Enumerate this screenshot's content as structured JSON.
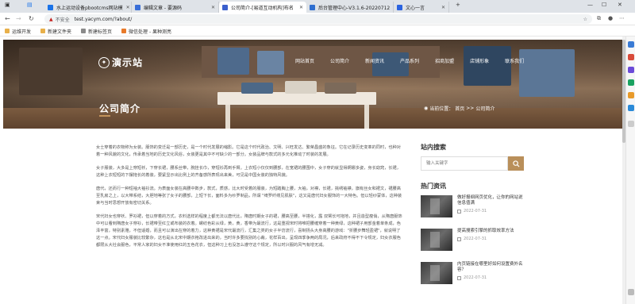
{
  "browser": {
    "tabs": [
      {
        "label": "水上运动设备pbootcms网站模",
        "color": "#1a73e8"
      },
      {
        "label": "编辑文章 - 要源码",
        "color": "#3a6fd8"
      },
      {
        "label": "公司简介-[易道互动机构]布名",
        "color": "#3a5fcd"
      },
      {
        "label": "后台管理中心-V3.1.6-20220712",
        "color": "#2f6fd0"
      },
      {
        "label": "文心一言",
        "color": "#2b63e0"
      }
    ],
    "new_tab": "+",
    "security_label": "不安全",
    "url": "test.yacym.com/?about/",
    "bookmarks": [
      {
        "label": "运维开发",
        "color": "#e8b04a"
      },
      {
        "label": "新建文件夹",
        "color": "#e8b04a"
      },
      {
        "label": "新建标签页",
        "color": "#8a8a8a"
      },
      {
        "label": "微信处理 - 果种测亮",
        "color": "#e87a2a"
      }
    ]
  },
  "site": {
    "logo_text": "演示站",
    "nav": [
      "网站首页",
      "公司简介",
      "新闻资讯",
      "产品系列",
      "招商加盟",
      "店铺形象",
      "联系我们"
    ],
    "page_title": "公司简介",
    "breadcrumb": {
      "prefix": "当前位置：",
      "home": "首页",
      "sep": ">>",
      "current": "公司简介"
    }
  },
  "article": {
    "paragraphs": [
      "女士穿着的衣物称为女装。服饰的变迁是一部历史，是一个时代发展的缩影。它是这个时代政治、文明、兴旺发达、繁荣昌盛的象征。它在记录历史变革的同时，也种对着一种风貌的文化，传承着当地的历史文化风俗，女装更是其中不可缺少的一部分。女装品牌与款式的多元化推动了时装的发展。",
      "女子服装，大多是上穿短袄，下穿长裙，腰系丝带，腕挂长巾，穿短衫再到手臂。上衣短小仅仅到腰部，在宽裙的腰围中，女子穿的就显得婀娜多姿，身长窈窕，长裙，这种上衣短短的下摆拖长的着装，要紧显示出比例上的齐备感所表现出来美，可见是中国女装的独特风貌。",
      "唐代，还而行一种短袖大袖衫流。为表面女装在高腰中数步，款式，质感，比大时受着的服装，为短踏胸上腰，大袖，对襟，长裙，挑绣袖襟，旗有丝女和裙文，裙腰高至乳房之上，以大带系结，大胆地等张了女子的腰部，上短下长，面料多为纱罗制品，所谓 \"绮罗纤缕见肌肤\"，这又是唐代妇女服饰的一大特色。但以轻纱蒙体，这种装束与当时思想开放有密切关系。",
      "宋代妇女也穿袄、罗衫裙，但以穿着的方式，衣料选样的程度上都无法以唐代比，隋唐时期女子的裙，腰高至腰，半搭化，露 双臂长可拖地，并且造型瘦俏，从隋唐服饰中可以看到隋唐女子穿衫，长裙带至红立或布装的衣着。螺纺色彩从绿，黄，黄，香带为最流行，这是重视宋时将唯把腰缠穿着一种黄绿，这种裙子用部金着单条成，色泽丰富，特别素雅，不但适婚，而且可以演出在穿的着力，这种黄裙是宋代最流行，汇集之类的女子半仿流行，喜制扬头大身高腰的游戏：\"折腰步舞轻盈裙\"，就说明了这一点。宋代妇女服装比较繁杂，这也是从北宋中期衣袍改进出来的，当时许多要找别的心裁，花样百出，呈现四季争两的局况，后来政府不得不下令规定，妇女衣服色都限从大社会服色，平常人家的妇女不准使用红的五色花衣，但这种习上也没怎么遵守这个规定，所以时兴服的风气有增无减。"
    ]
  },
  "sidebar": {
    "search_heading": "站内搜索",
    "search_placeholder": "输入关键字",
    "hot_heading": "热门资讯",
    "hot_items": [
      {
        "title": "做好报纲网页优化，让你的网站说信息值满",
        "date": "2022-07-31"
      },
      {
        "title": "提高搜索引擎的抓取效率方法",
        "date": "2022-07-31"
      },
      {
        "title": "内页链接在哪里好如何设置费外名容？",
        "date": "2022-07-31"
      }
    ]
  },
  "colors": {
    "accent": "#b98f5a",
    "hero_overlay": "#3b2a1e"
  }
}
